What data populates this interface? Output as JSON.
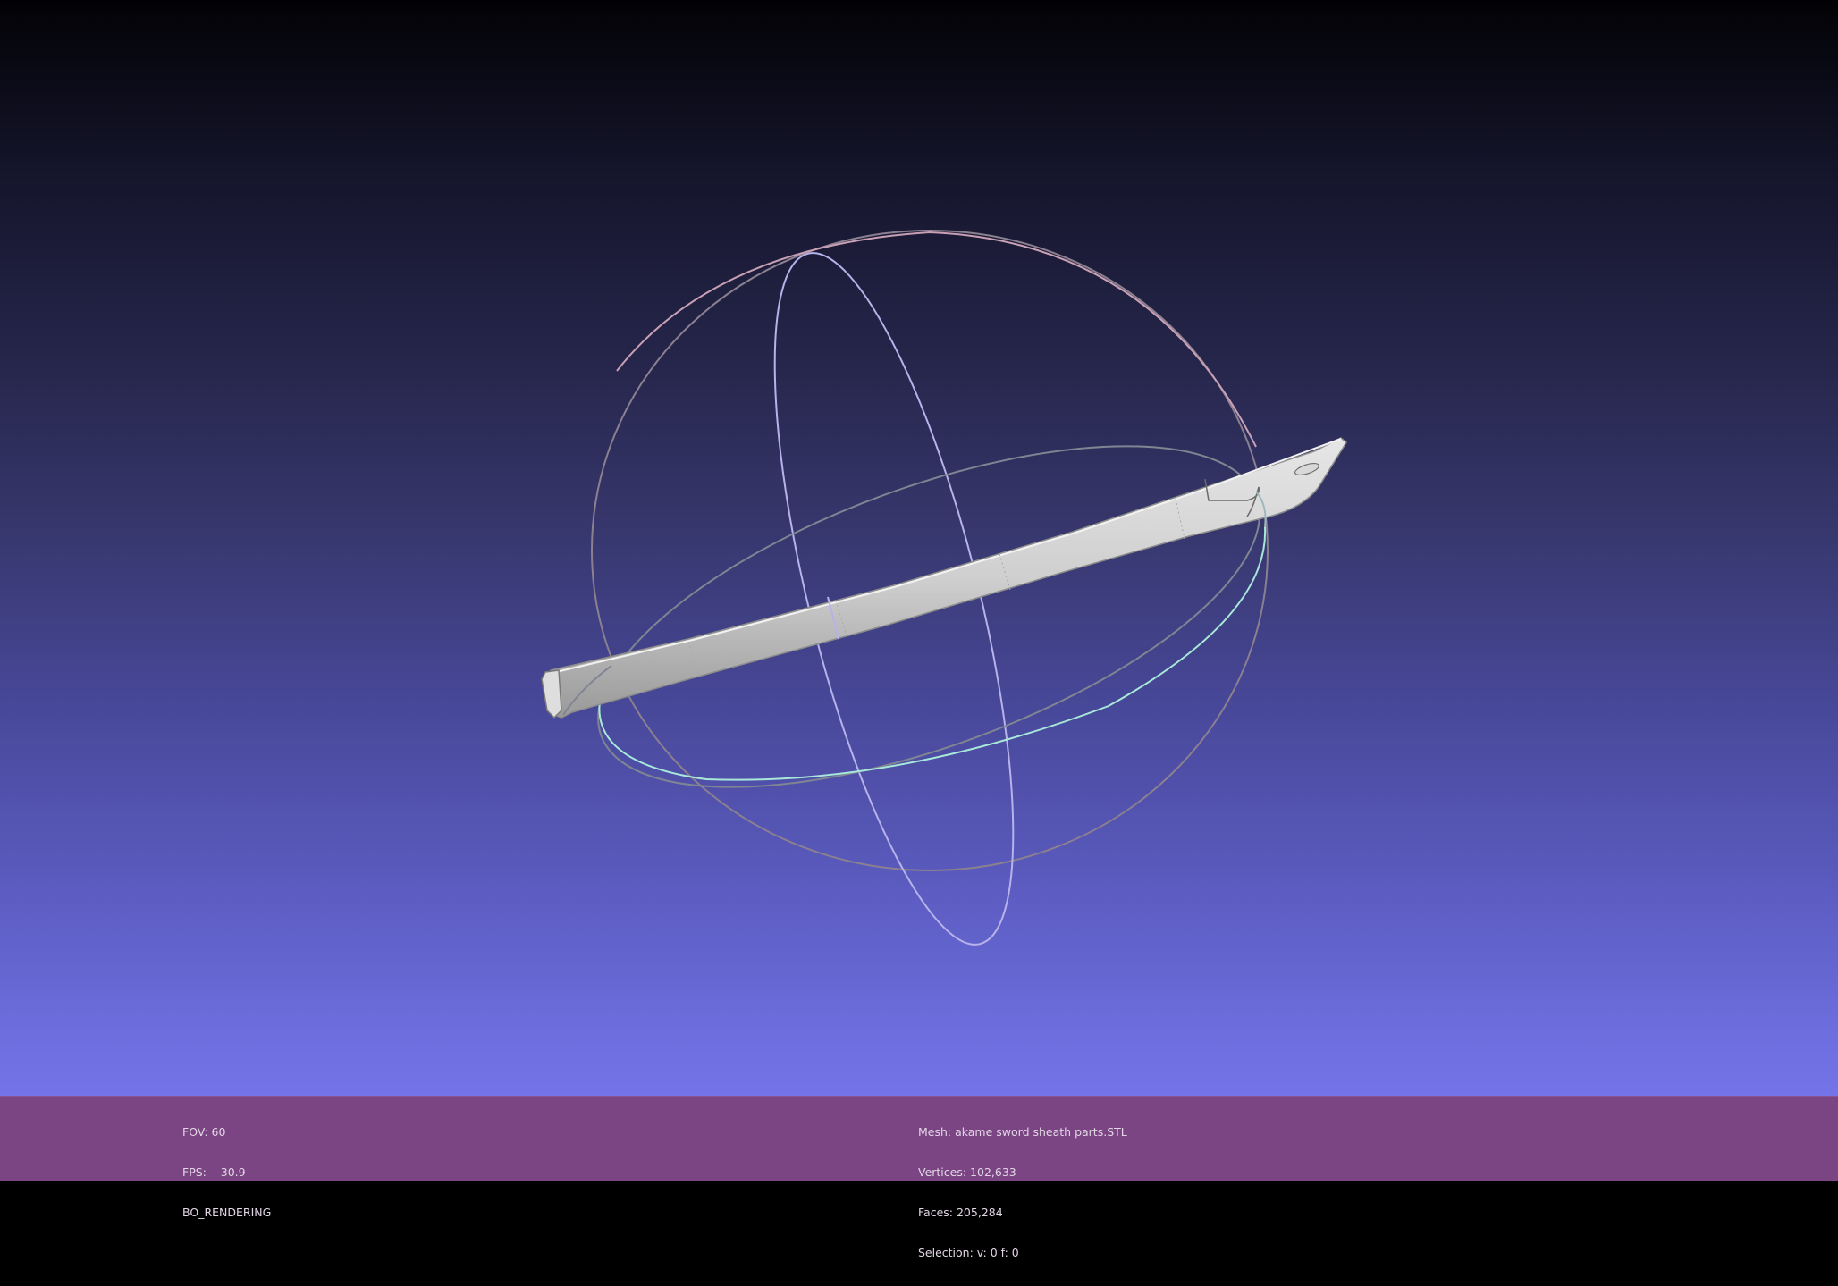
{
  "app": {
    "colors": {
      "background_top": "#020205",
      "background_bottom": "#7474e8",
      "status_bar": "#7b4583",
      "status_text": "#e2d6e6",
      "mesh": "#cfcfcf",
      "trackball_x": "#a0a0a0",
      "trackball_y": "#d0a0b0",
      "trackball_z": "#9fe0d0"
    }
  },
  "viewport": {
    "object": "sword-sheath-mesh",
    "trackball": "trackball-icon"
  },
  "status": {
    "fov": "FOV: 60",
    "fps": "FPS:    30.9",
    "render_mode": "BO_RENDERING",
    "mesh": "Mesh: akame sword sheath parts.STL",
    "vertices": "Vertices: 102,633",
    "faces": "Faces: 205,284",
    "selection": "Selection: v: 0 f: 0"
  }
}
